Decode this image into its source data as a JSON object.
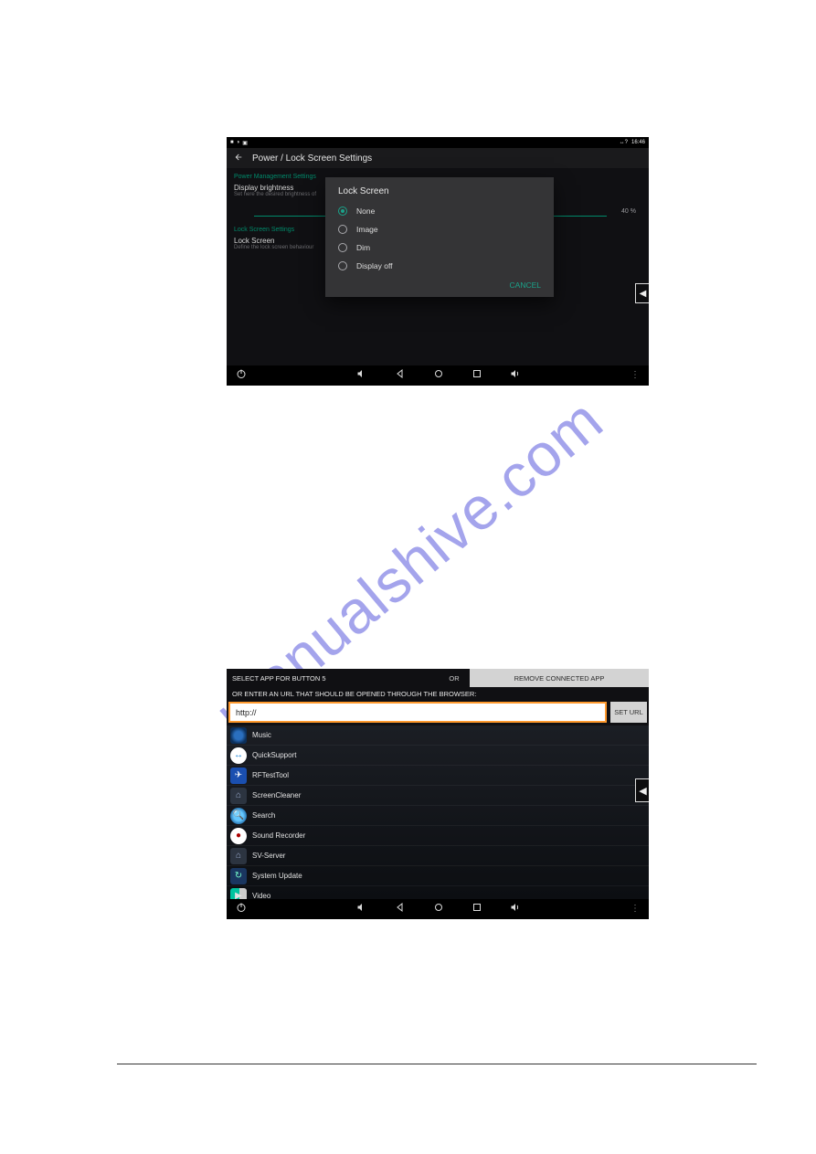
{
  "watermark": "manualshive.com",
  "status": {
    "time": "16:46",
    "wifi": "↔?"
  },
  "shot1": {
    "title": "Power / Lock Screen Settings",
    "section1": "Power Management Settings",
    "brightness_title": "Display brightness",
    "brightness_sub": "Set here the desired brightness of",
    "brightness_pct": "40 %",
    "section2": "Lock Screen Settings",
    "lock_title": "Lock Screen",
    "lock_sub": "Define the lock screen behaviour",
    "dialog": {
      "title": "Lock Screen",
      "opt1": "None",
      "opt2": "Image",
      "opt3": "Dim",
      "opt4": "Display off",
      "cancel": "CANCEL"
    },
    "side": "◀"
  },
  "shot2": {
    "head_left": "SELECT APP FOR BUTTON 5",
    "head_or": "OR",
    "remove": "REMOVE CONNECTED APP",
    "sub": "OR ENTER AN URL THAT SHOULD BE OPENED THROUGH THE BROWSER:",
    "url_value": "http://",
    "seturl": "SET URL",
    "apps": {
      "a0": "Music",
      "a1": "QuickSupport",
      "a2": "RFTestTool",
      "a3": "ScreenCleaner",
      "a4": "Search",
      "a5": "Sound Recorder",
      "a6": "SV-Server",
      "a7": "System Update",
      "a8": "Video"
    },
    "side": "◀"
  }
}
